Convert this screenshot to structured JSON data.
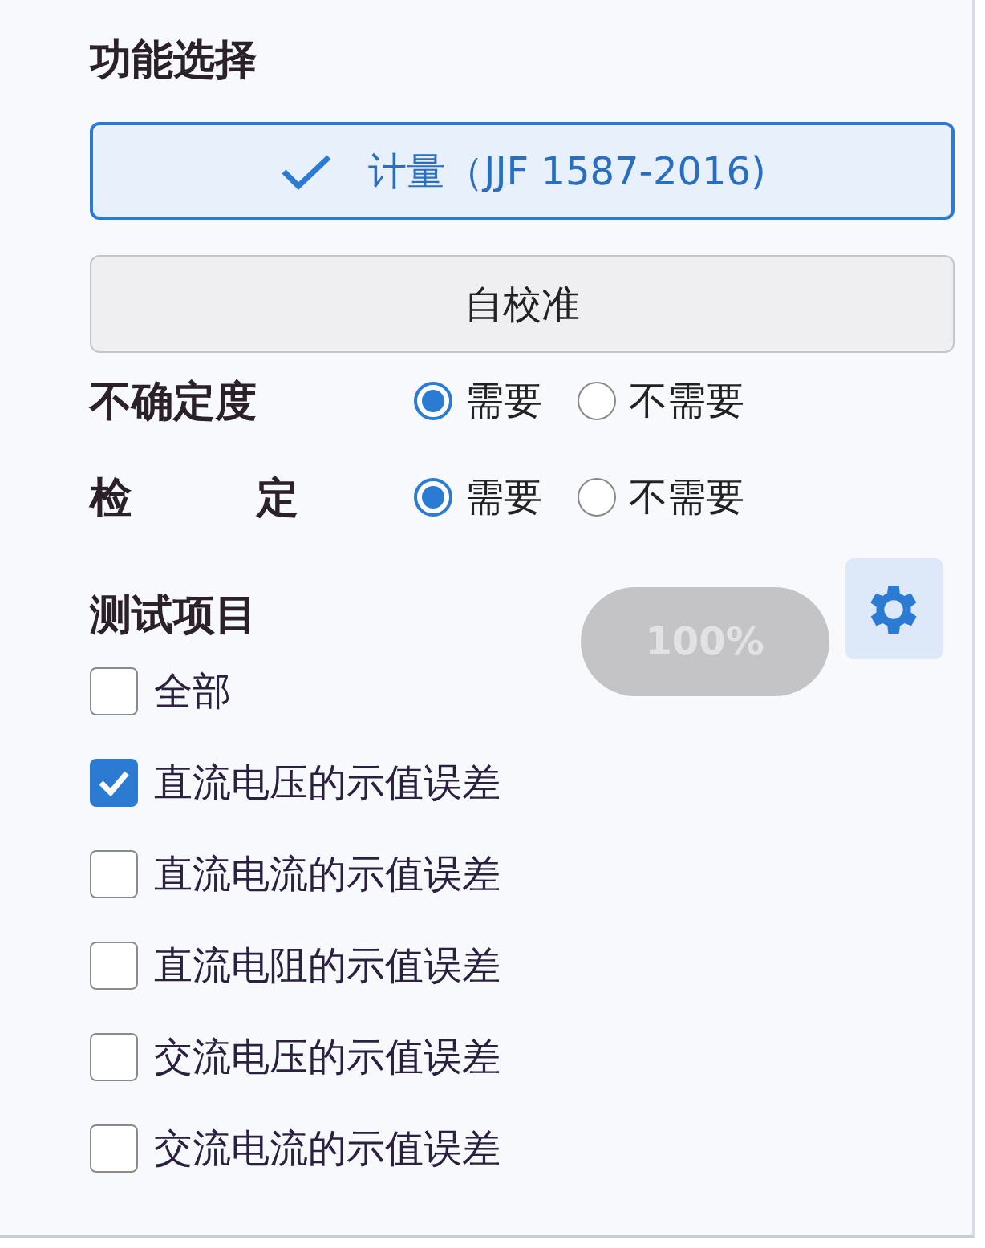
{
  "function_select": {
    "title": "功能选择",
    "modes": [
      {
        "label": "计量（JJF 1587-2016)",
        "selected": true
      },
      {
        "label": "自校准",
        "selected": false
      }
    ]
  },
  "options": [
    {
      "label": "不确定度",
      "choices": [
        {
          "label": "需要",
          "selected": true
        },
        {
          "label": "不需要",
          "selected": false
        }
      ]
    },
    {
      "label": "检　　　定",
      "choices": [
        {
          "label": "需要",
          "selected": true
        },
        {
          "label": "不需要",
          "selected": false
        }
      ]
    }
  ],
  "tests": {
    "title": "测试项目",
    "run_button": {
      "label": "100%",
      "disabled": true
    },
    "items": [
      {
        "label": "全部",
        "checked": false
      },
      {
        "label": "直流电压的示值误差",
        "checked": true
      },
      {
        "label": "直流电流的示值误差",
        "checked": false
      },
      {
        "label": "直流电阻的示值误差",
        "checked": false
      },
      {
        "label": "交流电压的示值误差",
        "checked": false
      },
      {
        "label": "交流电流的示值误差",
        "checked": false
      }
    ]
  }
}
